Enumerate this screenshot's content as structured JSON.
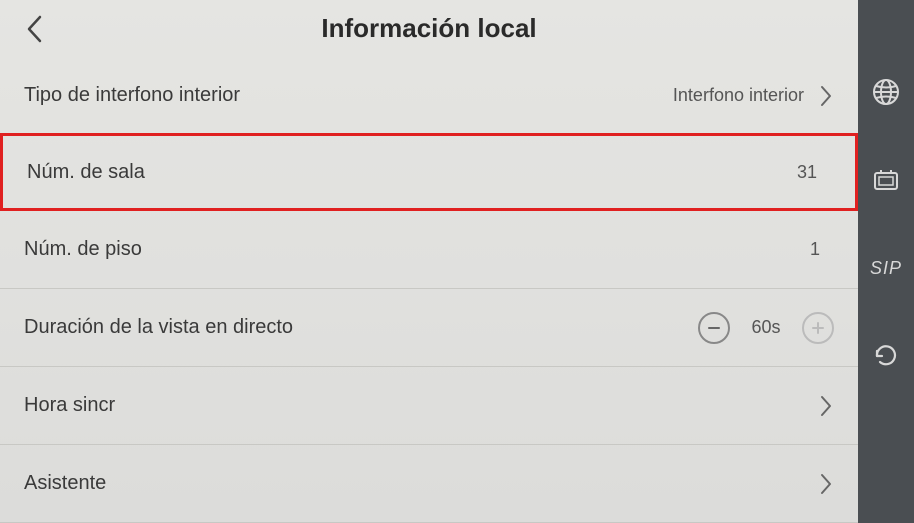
{
  "header": {
    "title": "Información local"
  },
  "rows": {
    "intercomType": {
      "label": "Tipo de interfono interior",
      "value": "Interfono interior"
    },
    "roomNo": {
      "label": "Núm. de sala",
      "value": "31"
    },
    "floorNo": {
      "label": "Núm. de piso",
      "value": "1"
    },
    "liveView": {
      "label": "Duración de la vista en directo",
      "value": "60s"
    },
    "syncTime": {
      "label": "Hora sincr"
    },
    "assistant": {
      "label": "Asistente"
    }
  },
  "sidebar": {
    "sip": "SIP"
  }
}
